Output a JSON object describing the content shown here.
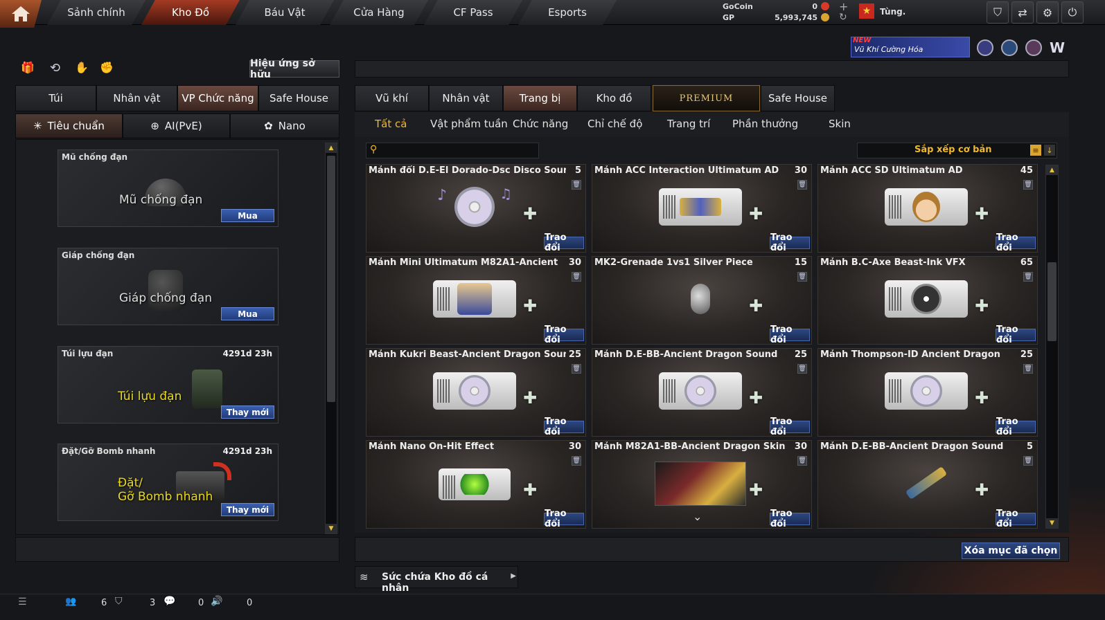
{
  "nav": {
    "tabs": [
      {
        "label": "Sảnh chính"
      },
      {
        "label": "Kho Đồ"
      },
      {
        "label": "Báu Vật"
      },
      {
        "label": "Cửa Hàng"
      },
      {
        "label": "CF Pass"
      },
      {
        "label": "Esports"
      }
    ],
    "active_tab": "Kho Đồ"
  },
  "currency": {
    "gocoin_label": "GoCoin",
    "gocoin_value": "0",
    "gp_label": "GP",
    "gp_value": "5,993,745",
    "plus": "+",
    "refresh": "↻"
  },
  "user": {
    "name": "Tùng."
  },
  "promo": {
    "badge": "NEW",
    "text": "Vũ Khí Cường Hóa"
  },
  "left": {
    "owned_effect_button": "Hiệu ứng sở hữu",
    "tabs": [
      "Túi",
      "Nhân vật",
      "VP Chức năng",
      "Safe House"
    ],
    "active_tab": "VP Chức năng",
    "subtabs": [
      "Tiêu chuẩn",
      "AI(PvE)",
      "Nano"
    ],
    "active_subtab": "Tiêu chuẩn",
    "items": [
      {
        "name": "Mũ chống đạn",
        "art_label": "Mũ chống đạn",
        "time": "",
        "button": "Mua"
      },
      {
        "name": "Giáp chống đạn",
        "art_label": "Giáp chống đạn",
        "time": "",
        "button": "Mua"
      },
      {
        "name": "Túi lựu đạn",
        "art_label": "Túi lựu đạn",
        "time": "4291d 23h",
        "button": "Thay mới"
      },
      {
        "name": "Đặt/Gỡ Bomb nhanh",
        "art_label_1": "Đặt/",
        "art_label_2": "Gỡ Bomb nhanh",
        "time": "4291d 23h",
        "button": "Thay mới"
      }
    ]
  },
  "right": {
    "tabs": [
      "Vũ khí",
      "Nhân vật",
      "Trang bị",
      "Kho đồ",
      "PREMIUM",
      "Safe House"
    ],
    "active_tab": "Trang bị",
    "filters": [
      "Tất cả",
      "Vật phẩm tuần",
      "Chức năng",
      "Chỉ chế độ",
      "Trang trí",
      "Phần thưởng",
      "Skin"
    ],
    "active_filter": "Tất cả",
    "search_placeholder": "",
    "sort_label": "Sắp xếp cơ bản",
    "trade_label": "Trao đổi",
    "items": [
      {
        "name": "Mảnh đổi D.E-El Dorado-Dsc Disco Sound",
        "qty": "5",
        "art": "disc-music"
      },
      {
        "name": "Mảnh ACC Interaction Ultimatum AD",
        "qty": "30",
        "art": "ticket-chars"
      },
      {
        "name": "Mảnh ACC SD Ultimatum AD",
        "qty": "45",
        "art": "ticket-face"
      },
      {
        "name": "Mảnh Mini Ultimatum M82A1-Ancient",
        "qty": "30",
        "art": "ticket-mini"
      },
      {
        "name": "MK2-Grenade 1vs1 Silver Piece",
        "qty": "15",
        "art": "grenade"
      },
      {
        "name": "Mảnh B.C-Axe Beast-Ink VFX",
        "qty": "65",
        "art": "ticket-gear"
      },
      {
        "name": "Mảnh Kukri Beast-Ancient Dragon Sound",
        "qty": "25",
        "art": "ticket-disc"
      },
      {
        "name": "Mảnh D.E-BB-Ancient Dragon Sound",
        "qty": "25",
        "art": "ticket-disc"
      },
      {
        "name": "Mảnh Thompson-ID Ancient Dragon",
        "qty": "25",
        "art": "ticket-disc"
      },
      {
        "name": "Mảnh Nano On-Hit Effect",
        "qty": "30",
        "art": "ticket-green"
      },
      {
        "name": "Mảnh M82A1-BB-Ancient Dragon Skin",
        "qty": "30",
        "art": "sniper"
      },
      {
        "name": "Mảnh D.E-BB-Ancient Dragon Sound",
        "qty": "5",
        "art": "axe"
      }
    ],
    "capacity_label": "Sức chứa Kho đồ cá nhân",
    "delete_selected": "Xóa mục đã chọn"
  },
  "status": {
    "friends": "6",
    "clan": "3",
    "chat": "0",
    "voice": "0"
  }
}
